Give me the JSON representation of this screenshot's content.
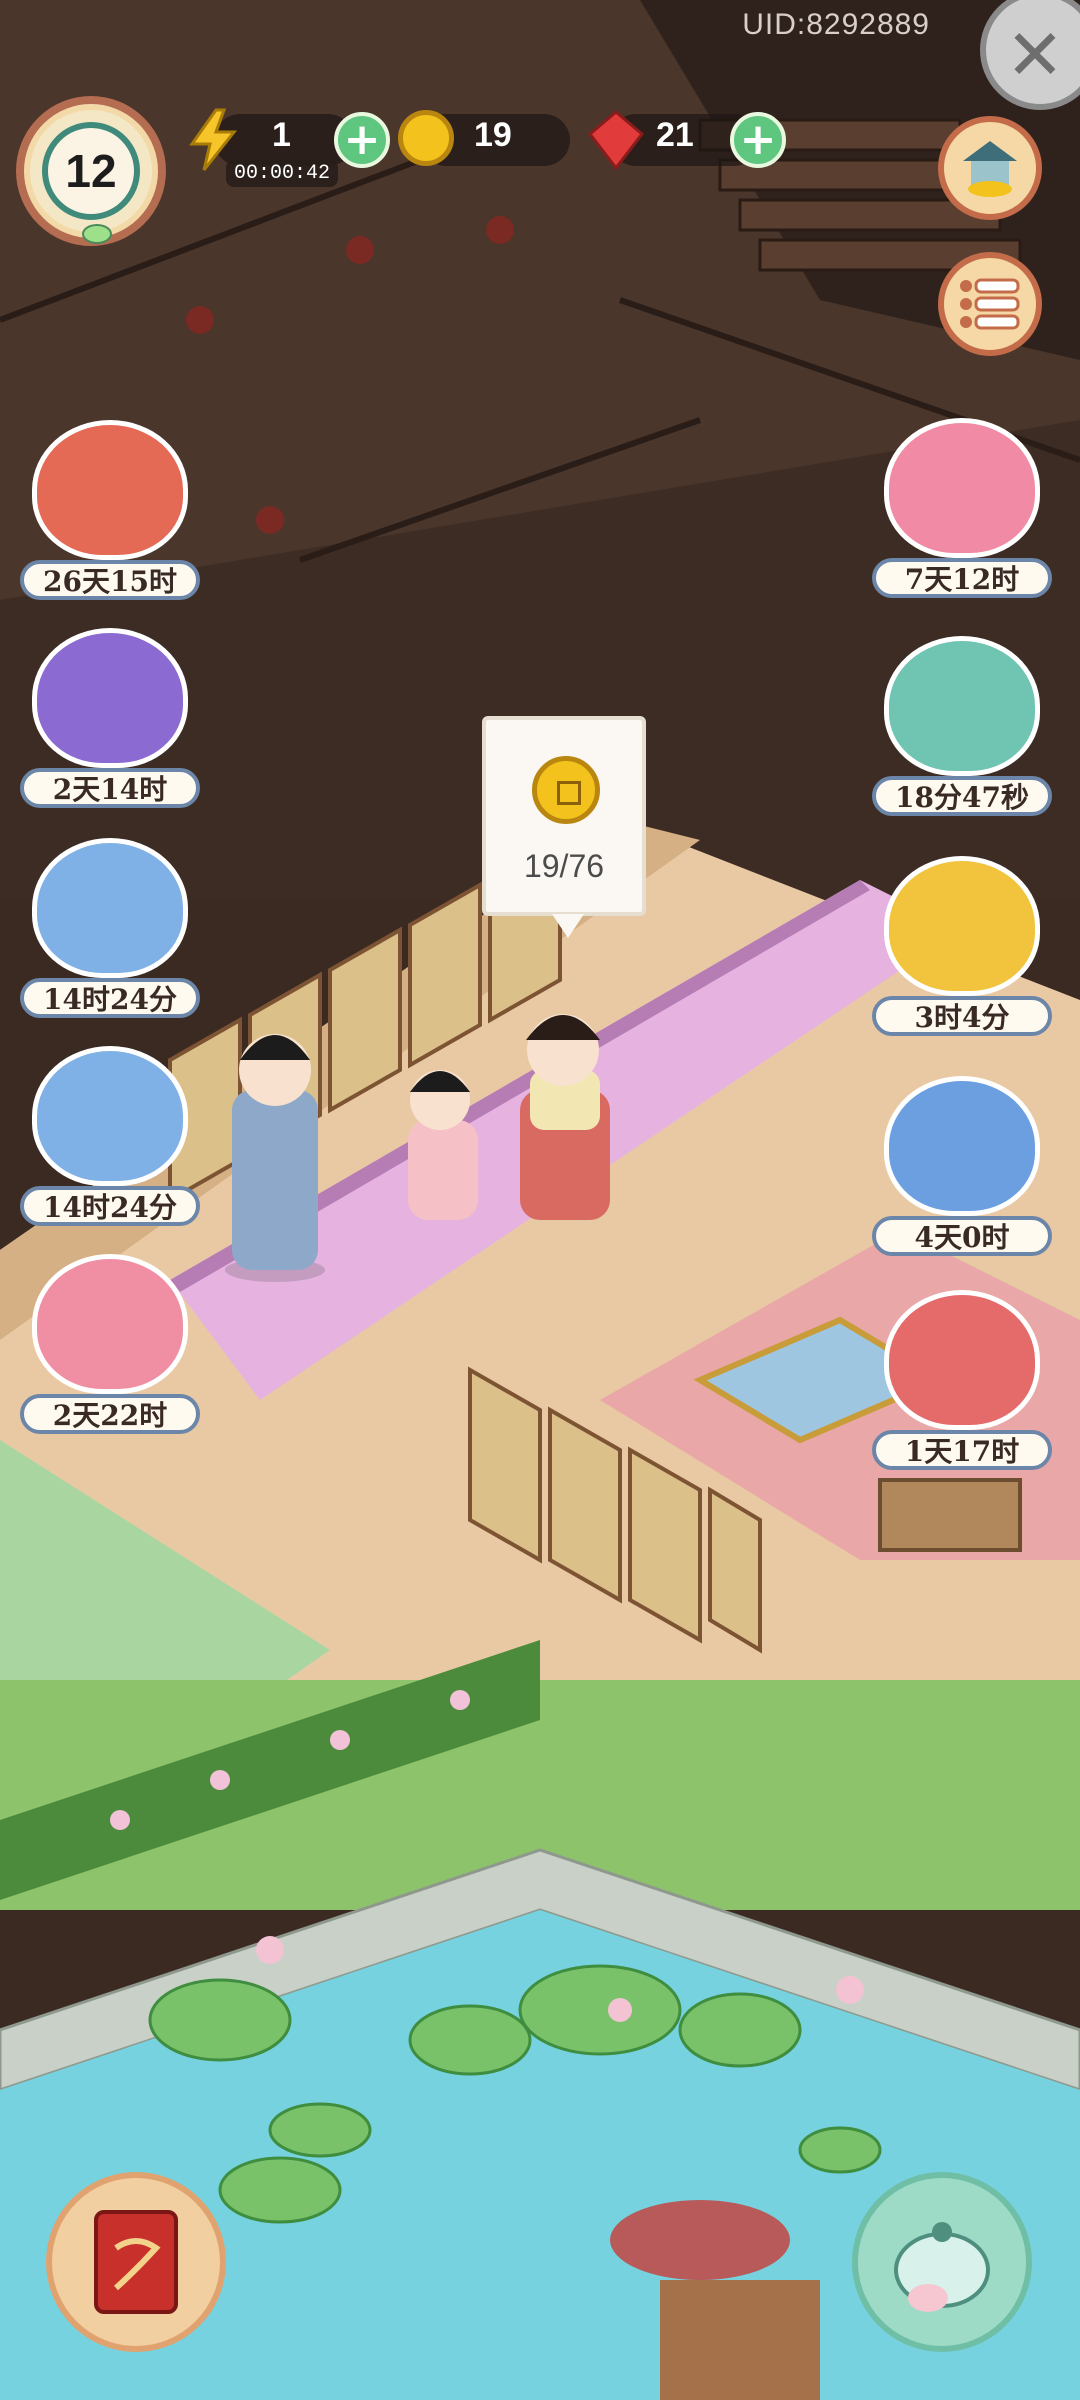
{
  "header": {
    "uid": "UID:8292889",
    "level": "12",
    "energy": {
      "value": "1",
      "timer": "00:00:42"
    },
    "coins": {
      "value": "19"
    },
    "gems": {
      "value": "21"
    }
  },
  "tooltip": {
    "progress": "19/76"
  },
  "events_left": [
    {
      "timer": "26天15时",
      "icon": "newspaper-flowers-icon"
    },
    {
      "timer": "2天14时",
      "icon": "rabbit-lantern-icon"
    },
    {
      "timer": "14时24分",
      "icon": "mooncake-icon"
    },
    {
      "timer": "14时24分",
      "icon": "moon-rabbit-icon"
    },
    {
      "timer": "2天22时",
      "icon": "mouse-gem-icon"
    }
  ],
  "events_right": [
    {
      "timer": "7天12时",
      "icon": "white-rabbit-icon"
    },
    {
      "timer": "18分47秒",
      "icon": "lucky-cat-treasure-icon"
    },
    {
      "timer": "3时4分",
      "icon": "golden-chest-icon"
    },
    {
      "timer": "4天0时",
      "icon": "rabbit-chest-icon"
    },
    {
      "timer": "1天17时",
      "icon": "girl-gift-icon"
    }
  ],
  "colors": {
    "accent_green": "#5ec67f",
    "frame_red": "#c46c49",
    "carpet_pink": "#e9b2e0"
  }
}
